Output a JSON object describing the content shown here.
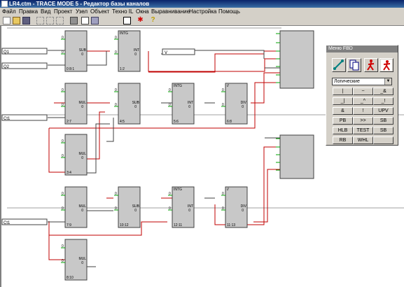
{
  "window": {
    "title": "LR4.ctm - TRACE MODE 5 - Редактор базы каналов"
  },
  "menu": [
    "Файл",
    "Правка",
    "Вид",
    "Проект",
    "Узел",
    "Объект",
    "Техно IL",
    "Окна",
    "Выравнивание",
    "Настройка",
    "Помощь"
  ],
  "toolbar_icons": [
    "new-icon",
    "open-icon",
    "save-icon",
    "cut-icon",
    "copy-icon",
    "paste-icon",
    "print-icon",
    "grid-icon",
    "zoom-icon",
    "properties-icon",
    "run-icon",
    "help-icon"
  ],
  "inputs": [
    {
      "label": "Q1"
    },
    {
      "label": "Q2"
    },
    {
      "label": "Ct1"
    },
    {
      "label": "Ct1"
    }
  ],
  "blocks": [
    {
      "op": "SUB",
      "id": "0 8:1",
      "header": "",
      "pins": [
        "0",
        "0"
      ]
    },
    {
      "op": "INT",
      "id": "1:2",
      "header": "INTG",
      "pins": [
        "0",
        "0"
      ]
    },
    {
      "op": "MUL",
      "id": "2:7",
      "header": "",
      "pins": [
        "0",
        "0"
      ]
    },
    {
      "op": "SUB",
      "id": "4:5",
      "header": "",
      "pins": [
        "0",
        "0"
      ]
    },
    {
      "op": "INT",
      "id": "5:6",
      "header": "INTG",
      "pins": [
        "0",
        "0"
      ]
    },
    {
      "op": "DIV",
      "id": "6:8",
      "header": "//",
      "pins": [
        "0",
        "0"
      ]
    },
    {
      "op": "MUL",
      "id": "3:4",
      "header": "",
      "pins": [
        "0",
        "0"
      ]
    },
    {
      "op": "MUL",
      "id": "7:9",
      "header": "",
      "pins": [
        "0",
        "0"
      ]
    },
    {
      "op": "SUB",
      "id": "10:12",
      "header": "",
      "pins": [
        "0",
        "0"
      ]
    },
    {
      "op": "INT",
      "id": "12:11",
      "header": "INTG",
      "pins": [
        "0",
        "0"
      ]
    },
    {
      "op": "DIV",
      "id": "11:13",
      "header": "//",
      "pins": [
        "0",
        "0"
      ]
    },
    {
      "op": "MUL",
      "id": "8:10",
      "header": "",
      "pins": [
        "0",
        "0"
      ]
    }
  ],
  "value_field": {
    "text": "V"
  },
  "fbd_menu": {
    "title": "Меню FBD",
    "select_value": "Логические",
    "buttons": [
      "|",
      "~",
      "_&",
      "_|",
      "_^",
      "_!",
      "&",
      "!",
      "UPV",
      "PB",
      ">>",
      "SB",
      "HLB",
      "TEST",
      "SB",
      "RB",
      "WHL",
      ""
    ]
  }
}
